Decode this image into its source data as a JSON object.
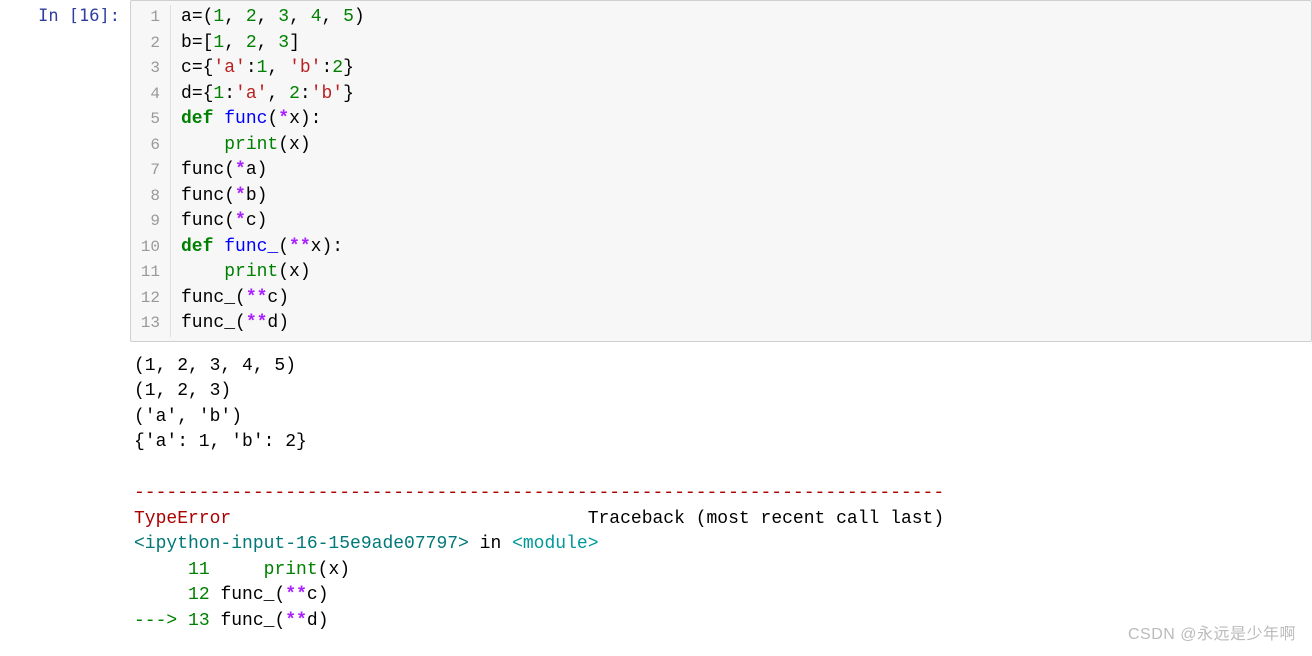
{
  "prompt": {
    "label": "In ",
    "number": "[16]",
    "colon": ":"
  },
  "code": {
    "lines": [
      [
        {
          "t": "a",
          "c": "norm"
        },
        {
          "t": "=(",
          "c": "punc"
        },
        {
          "t": "1",
          "c": "num"
        },
        {
          "t": ", ",
          "c": "punc"
        },
        {
          "t": "2",
          "c": "num"
        },
        {
          "t": ", ",
          "c": "punc"
        },
        {
          "t": "3",
          "c": "num"
        },
        {
          "t": ", ",
          "c": "punc"
        },
        {
          "t": "4",
          "c": "num"
        },
        {
          "t": ", ",
          "c": "punc"
        },
        {
          "t": "5",
          "c": "num"
        },
        {
          "t": ")",
          "c": "punc"
        }
      ],
      [
        {
          "t": "b",
          "c": "norm"
        },
        {
          "t": "=[",
          "c": "punc"
        },
        {
          "t": "1",
          "c": "num"
        },
        {
          "t": ", ",
          "c": "punc"
        },
        {
          "t": "2",
          "c": "num"
        },
        {
          "t": ", ",
          "c": "punc"
        },
        {
          "t": "3",
          "c": "num"
        },
        {
          "t": "]",
          "c": "punc"
        }
      ],
      [
        {
          "t": "c",
          "c": "norm"
        },
        {
          "t": "={",
          "c": "punc"
        },
        {
          "t": "'a'",
          "c": "str"
        },
        {
          "t": ":",
          "c": "punc"
        },
        {
          "t": "1",
          "c": "num"
        },
        {
          "t": ", ",
          "c": "punc"
        },
        {
          "t": "'b'",
          "c": "str"
        },
        {
          "t": ":",
          "c": "punc"
        },
        {
          "t": "2",
          "c": "num"
        },
        {
          "t": "}",
          "c": "punc"
        }
      ],
      [
        {
          "t": "d",
          "c": "norm"
        },
        {
          "t": "={",
          "c": "punc"
        },
        {
          "t": "1",
          "c": "num"
        },
        {
          "t": ":",
          "c": "punc"
        },
        {
          "t": "'a'",
          "c": "str"
        },
        {
          "t": ", ",
          "c": "punc"
        },
        {
          "t": "2",
          "c": "num"
        },
        {
          "t": ":",
          "c": "punc"
        },
        {
          "t": "'b'",
          "c": "str"
        },
        {
          "t": "}",
          "c": "punc"
        }
      ],
      [
        {
          "t": "def",
          "c": "kw"
        },
        {
          "t": " ",
          "c": "norm"
        },
        {
          "t": "func",
          "c": "fn"
        },
        {
          "t": "(",
          "c": "punc"
        },
        {
          "t": "*",
          "c": "star"
        },
        {
          "t": "x):",
          "c": "punc"
        }
      ],
      [
        {
          "t": "    ",
          "c": "norm"
        },
        {
          "t": "print",
          "c": "builtin"
        },
        {
          "t": "(x)",
          "c": "punc"
        }
      ],
      [
        {
          "t": "func(",
          "c": "norm"
        },
        {
          "t": "*",
          "c": "star"
        },
        {
          "t": "a)",
          "c": "norm"
        }
      ],
      [
        {
          "t": "func(",
          "c": "norm"
        },
        {
          "t": "*",
          "c": "star"
        },
        {
          "t": "b)",
          "c": "norm"
        }
      ],
      [
        {
          "t": "func(",
          "c": "norm"
        },
        {
          "t": "*",
          "c": "star"
        },
        {
          "t": "c)",
          "c": "norm"
        }
      ],
      [
        {
          "t": "def",
          "c": "kw"
        },
        {
          "t": " ",
          "c": "norm"
        },
        {
          "t": "func_",
          "c": "fn"
        },
        {
          "t": "(",
          "c": "punc"
        },
        {
          "t": "**",
          "c": "star"
        },
        {
          "t": "x):",
          "c": "punc"
        }
      ],
      [
        {
          "t": "    ",
          "c": "norm"
        },
        {
          "t": "print",
          "c": "builtin"
        },
        {
          "t": "(x)",
          "c": "punc"
        }
      ],
      [
        {
          "t": "func_(",
          "c": "norm"
        },
        {
          "t": "**",
          "c": "star"
        },
        {
          "t": "c)",
          "c": "norm"
        }
      ],
      [
        {
          "t": "func_(",
          "c": "norm"
        },
        {
          "t": "**",
          "c": "star"
        },
        {
          "t": "d)",
          "c": "norm"
        }
      ]
    ],
    "gutter": [
      "1",
      "2",
      "3",
      "4",
      "5",
      "6",
      "7",
      "8",
      "9",
      "10",
      "11",
      "12",
      "13"
    ]
  },
  "output": {
    "plain": [
      "(1, 2, 3, 4, 5)",
      "(1, 2, 3)",
      "('a', 'b')",
      "{'a': 1, 'b': 2}"
    ],
    "blank": "",
    "dashes": "---------------------------------------------------------------------------",
    "head": {
      "errtype": "TypeError",
      "spacer": "                                 ",
      "trace": "Traceback (most recent call last)"
    },
    "frame_loc": {
      "pre": "<ipython-input-16-15e9ade07797>",
      "mid": " in ",
      "mod": "<module>"
    },
    "ctx": [
      {
        "arrow": "     ",
        "num": "11",
        "sp": "     ",
        "segs": [
          {
            "t": "print",
            "c": "tb-ansi-green"
          },
          {
            "t": "(",
            "c": "tb-plain"
          },
          {
            "t": "x",
            "c": "tb-plain"
          },
          {
            "t": ")",
            "c": "tb-plain"
          }
        ]
      },
      {
        "arrow": "     ",
        "num": "12",
        "sp": " ",
        "segs": [
          {
            "t": "func_",
            "c": "tb-plain"
          },
          {
            "t": "(",
            "c": "tb-plain"
          },
          {
            "t": "**",
            "c": "star"
          },
          {
            "t": "c",
            "c": "tb-plain"
          },
          {
            "t": ")",
            "c": "tb-plain"
          }
        ]
      },
      {
        "arrow": "---> ",
        "num": "13",
        "sp": " ",
        "segs": [
          {
            "t": "func_",
            "c": "tb-plain"
          },
          {
            "t": "(",
            "c": "tb-plain"
          },
          {
            "t": "**",
            "c": "star"
          },
          {
            "t": "d",
            "c": "tb-plain"
          },
          {
            "t": ")",
            "c": "tb-plain"
          }
        ]
      }
    ]
  },
  "watermark": "CSDN @永远是少年啊"
}
